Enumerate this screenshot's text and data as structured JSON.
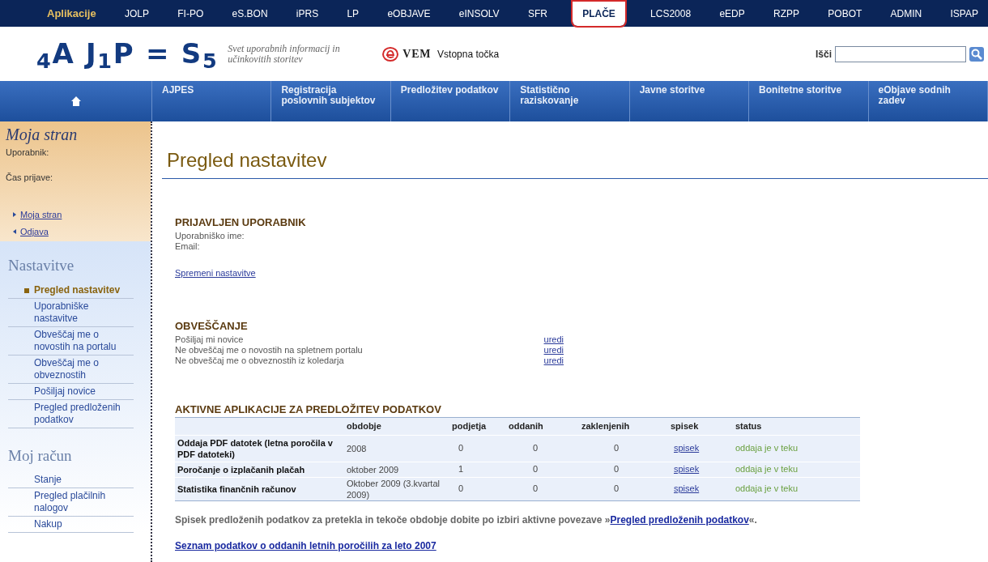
{
  "app_bar": {
    "label": "Aplikacije",
    "apps": [
      {
        "label": "JOLP",
        "selected": false
      },
      {
        "label": "FI-PO",
        "selected": false
      },
      {
        "label": "eS.BON",
        "selected": false
      },
      {
        "label": "iPRS",
        "selected": false
      },
      {
        "label": "LP",
        "selected": false
      },
      {
        "label": "eOBJAVE",
        "selected": false
      },
      {
        "label": "eINSOLV",
        "selected": false
      },
      {
        "label": "SFR",
        "selected": false
      },
      {
        "label": "PLAČE",
        "selected": true
      },
      {
        "label": "LCS2008",
        "selected": false
      },
      {
        "label": "eEDP",
        "selected": false
      },
      {
        "label": "RZPP",
        "selected": false
      },
      {
        "label": "POBOT",
        "selected": false
      },
      {
        "label": "ADMIN",
        "selected": false
      },
      {
        "label": "ISPAP",
        "selected": false
      }
    ]
  },
  "header": {
    "logo": "$_{4}$A J$_{1}$P = S$_{5}$",
    "tagline": "Svet uporabnih informacij in učinkovitih storitev",
    "vem_logo": "VEM",
    "vem_label": "Vstopna točka",
    "search_label": "Išči"
  },
  "nav": [
    {
      "label": "AJPES"
    },
    {
      "label": "Registracija poslovnih subjektov"
    },
    {
      "label": "Predložitev podatkov"
    },
    {
      "label": "Statistično raziskovanje"
    },
    {
      "label": "Javne storitve"
    },
    {
      "label": "Bonitetne storitve"
    },
    {
      "label": "eObjave sodnih zadev"
    }
  ],
  "sidebar": {
    "title": "Moja stran",
    "user_label": "Uporabnik:",
    "login_time_label": "Čas prijave:",
    "links": [
      {
        "label": "Moja stran",
        "kind": "forward"
      },
      {
        "label": "Odjava",
        "kind": "back"
      }
    ],
    "sections": [
      {
        "title": "Nastavitve",
        "items": [
          {
            "label": "Pregled nastavitev",
            "selected": true
          },
          {
            "label": "Uporabniške nastavitve",
            "selected": false
          },
          {
            "label": "Obveščaj me o novostih na portalu",
            "selected": false
          },
          {
            "label": "Obveščaj me o obveznostih",
            "selected": false
          },
          {
            "label": "Pošiljaj novice",
            "selected": false
          },
          {
            "label": "Pregled predloženih podatkov",
            "selected": false
          }
        ]
      },
      {
        "title": "Moj račun",
        "items": [
          {
            "label": "Stanje",
            "selected": false
          },
          {
            "label": "Pregled plačilnih nalogov",
            "selected": false
          },
          {
            "label": "Nakup",
            "selected": false
          }
        ]
      }
    ]
  },
  "page_title": "Pregled nastavitev",
  "user_section": {
    "title": "PRIJAVLJEN UPORABNIK",
    "fields": [
      "Uporabniško ime:",
      "Email:"
    ],
    "link": "Spremeni nastavitve"
  },
  "notify_section": {
    "title": "OBVEŠČANJE",
    "rows": [
      {
        "label": "Pošiljaj mi novice",
        "action": "uredi"
      },
      {
        "label": "Ne obveščaj me o novostih na spletnem portalu",
        "action": "uredi"
      },
      {
        "label": "Ne obveščaj me o obveznostih iz koledarja",
        "action": "uredi"
      }
    ]
  },
  "apps_table": {
    "title": "AKTIVNE APLIKACIJE ZA PREDLOŽITEV PODATKOV",
    "columns": [
      "obdobje",
      "podjetja",
      "oddanih",
      "zaklenjenih",
      "spisek",
      "status"
    ],
    "rows": [
      {
        "name": "Oddaja PDF datotek (letna poročila v PDF datoteki)",
        "period": "2008",
        "companies": "0",
        "submitted": "0",
        "locked": "0",
        "list": "spisek",
        "status": "oddaja je v teku"
      },
      {
        "name": "Poročanje o izplačanih plačah",
        "period": "oktober 2009",
        "companies": "1",
        "submitted": "0",
        "locked": "0",
        "list": "spisek",
        "status": "oddaja je v teku"
      },
      {
        "name": "Statistika finančnih računov",
        "period": "Oktober 2009 (3.kvartal 2009)",
        "companies": "0",
        "submitted": "0",
        "locked": "0",
        "list": "spisek",
        "status": "oddaja je v teku"
      }
    ]
  },
  "note": "Spisek predloženih podatkov za pretekla in tekoče obdobje dobite po izbiri aktivne povezave »",
  "note_link": "Pregled predloženih podatkov",
  "note_end": "«.",
  "bottom_link": "Seznam podatkov o oddanih letnih poročilih za leto 2007"
}
